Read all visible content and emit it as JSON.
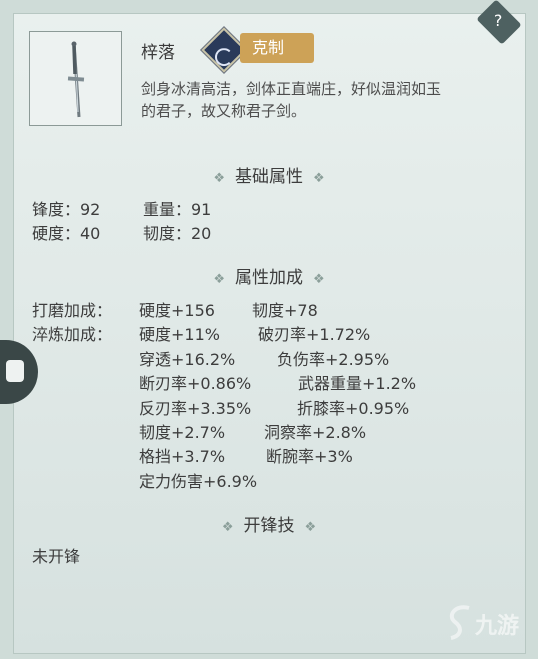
{
  "item": {
    "name": "梓落",
    "counter_label": "克制",
    "description": "剑身冰清高洁，剑体正直端庄，好似温润如玉的君子，故又称君子剑。",
    "description_line1": "剑身冰清高洁，剑体正直端庄，好似温润如玉",
    "description_line2": "的君子，故又称君子剑。"
  },
  "base": {
    "title": "基础属性",
    "row1": [
      "锋度：92",
      "重量：91"
    ],
    "row2": [
      "硬度：40",
      "韧度：20"
    ]
  },
  "bonus": {
    "title": "属性加成",
    "grind_label": "打磨加成：",
    "grind": [
      "硬度+156",
      "韧度+78"
    ],
    "temper_label": "淬炼加成：",
    "temper_rows": [
      [
        "硬度+11%",
        "破刃率+1.72%"
      ],
      [
        "穿透+16.2%",
        "负伤率+2.95%"
      ],
      [
        "断刃率+0.86%",
        "武器重量+1.2%"
      ],
      [
        "反刃率+3.35%",
        "折膝率+0.95%"
      ],
      [
        "韧度+2.7%",
        "洞察率+2.8%"
      ],
      [
        "格挡+3.7%",
        "断腕率+3%"
      ],
      [
        "定力伤害+6.9%",
        ""
      ]
    ]
  },
  "edge": {
    "title": "开锋技",
    "status": "未开锋"
  },
  "corner": {
    "glyph": "?"
  },
  "watermark": {
    "text": "九游"
  },
  "colors": {
    "counter_gold": "#cda257",
    "panel_bg": "#e9f0ee",
    "side_button": "#3a4747"
  }
}
